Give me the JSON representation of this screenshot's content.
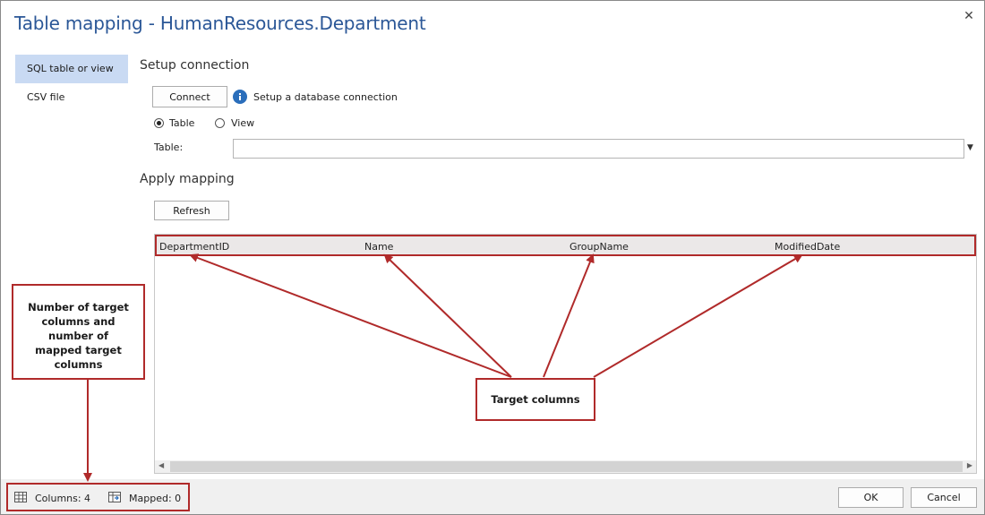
{
  "window": {
    "title": "Table mapping - HumanResources.Department",
    "close_glyph": "✕"
  },
  "nav": {
    "items": [
      {
        "label": "SQL table or view",
        "active": true
      },
      {
        "label": "CSV file",
        "active": false
      }
    ]
  },
  "setup": {
    "heading": "Setup connection",
    "connect_label": "Connect",
    "info_text": "Setup a database connection",
    "radio_table": "Table",
    "radio_view": "View",
    "selected_source": "Table",
    "table_label": "Table:",
    "table_value": ""
  },
  "mapping": {
    "heading": "Apply mapping",
    "refresh_label": "Refresh",
    "columns": [
      "DepartmentID",
      "Name",
      "GroupName",
      "ModifiedDate"
    ]
  },
  "callouts": {
    "left_text": [
      "Number of target",
      "columns and",
      "number of",
      "mapped target",
      "columns"
    ],
    "mid_text": "Target columns"
  },
  "footer": {
    "columns_text": "Columns: 4",
    "mapped_text": "Mapped: 0",
    "ok_label": "OK",
    "cancel_label": "Cancel"
  },
  "colors": {
    "title": "#2b5797",
    "nav_active": "#c9daf3",
    "annotation": "#b02a2a",
    "header_bg": "#ebe8e8"
  },
  "icons": {
    "info": "info-icon",
    "columns": "table-icon",
    "mapped": "mapped-columns-icon",
    "dropdown": "chevron-down-icon"
  }
}
